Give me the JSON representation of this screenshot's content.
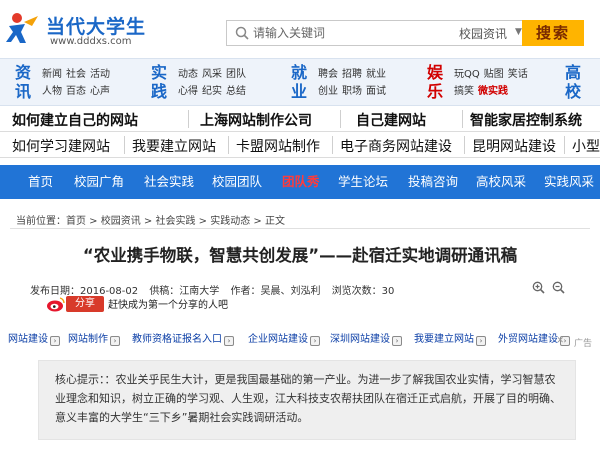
{
  "logo": {
    "name": "当代大学生",
    "domain": "www.dddxs.com"
  },
  "search": {
    "placeholder": "请输入关键词",
    "category": "校园资讯",
    "button": "搜索"
  },
  "categories": [
    {
      "title": "资讯",
      "color": "#1a67c7",
      "row1": [
        "新闻",
        "社会",
        "活动"
      ],
      "row2": [
        "人物",
        "百态",
        "心声"
      ]
    },
    {
      "title": "实践",
      "color": "#1a67c7",
      "row1": [
        "动态",
        "风采",
        "团队"
      ],
      "row2": [
        "心得",
        "纪实",
        "总结"
      ]
    },
    {
      "title": "就业",
      "color": "#1a67c7",
      "row1": [
        "聘会",
        "招聘",
        "就业"
      ],
      "row2": [
        "创业",
        "职场",
        "面试"
      ]
    },
    {
      "title": "娱乐",
      "color": "#d10000",
      "row1": [
        "玩QQ",
        "贴图",
        "笑话"
      ],
      "row2": [
        "搞笑",
        "微实践"
      ],
      "highlight": "微实践"
    },
    {
      "title": "高校",
      "color": "#1a67c7",
      "row1": [],
      "row2": []
    }
  ],
  "link_row_1": [
    "如何建立自己的网站",
    "上海网站制作公司",
    "自己建网站",
    "智能家居控制系统"
  ],
  "link_row_2": [
    "如何学习建网站",
    "我要建立网站",
    "卡盟网站制作",
    "电子商务网站建设",
    "昆明网站建设",
    "小型"
  ],
  "nav": {
    "items": [
      "首页",
      "校园广角",
      "社会实践",
      "校园团队",
      "团队秀",
      "学生论坛",
      "投稿咨询",
      "高校风采",
      "实践风采"
    ],
    "active": "团队秀"
  },
  "breadcrumb": "当前位置：首页 > 校园资讯 > 社会实践 > 实践动态 > 正文",
  "article": {
    "title": "“农业携手物联，智慧共创发展”——赴宿迁实地调研通讯稿",
    "date": "发布日期：2016-08-02",
    "source": "供稿：江南大学",
    "author": "作者：吴晨、刘泓利",
    "views": "浏览次数：30",
    "share_button": "分享",
    "share_note": "赶快成为第一个分享的人吧"
  },
  "ads": [
    "网站建设",
    "网站制作",
    "教师资格证报名入口",
    "企业网站建设",
    "深圳网站建设",
    "我要建立网站",
    "外贸网站建设"
  ],
  "ad_label": "广告",
  "summary": "核心提示：：农业关乎民生大计，更是我国最基础的第一产业。为进一步了解我国农业实情，学习智慧农业理念和知识，树立正确的学习观、人生观，江大科技支农帮扶团队在宿迁正式启航，开展了目的明确、意义丰富的大学生“三下乡”暑期社会实践调研活动。"
}
